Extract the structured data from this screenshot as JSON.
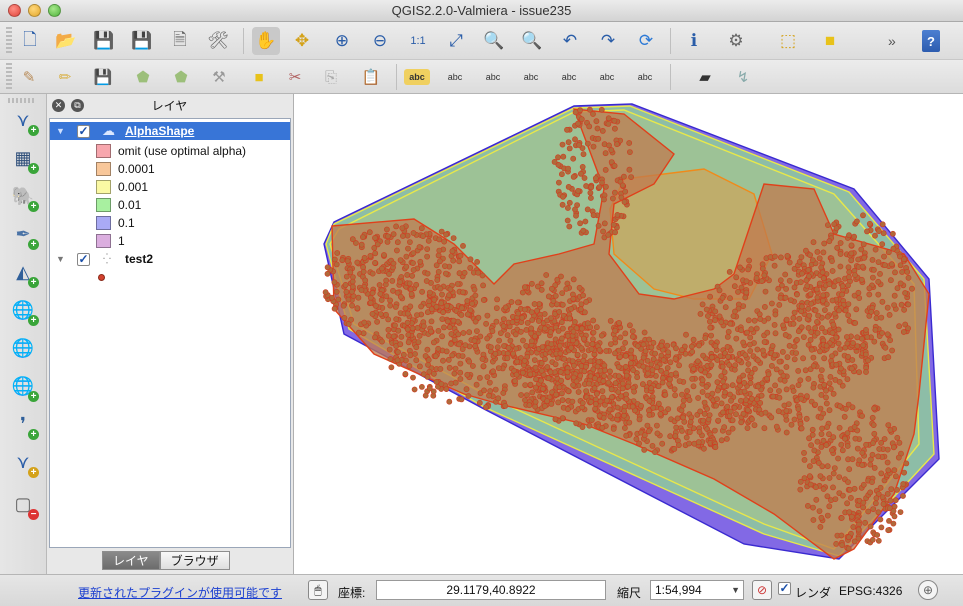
{
  "window": {
    "title": "QGIS2.2.0-Valmiera - issue235"
  },
  "toolbar_top": {
    "buttons": [
      "new-project",
      "open-project",
      "save-project",
      "save-as",
      "new-print-composer",
      "composer-manager",
      "pan",
      "pan-to-selection",
      "zoom-in",
      "zoom-out",
      "zoom-actual",
      "zoom-full",
      "zoom-layer",
      "zoom-selection",
      "zoom-last",
      "zoom-next",
      "refresh",
      "identify",
      "actions",
      "select",
      "deselect"
    ],
    "overflow": "»",
    "help": "?"
  },
  "toolbar_second": {
    "buttons": [
      "current-edits",
      "toggle-editing",
      "save-edits",
      "add-feature",
      "move-feature",
      "node-tool",
      "delete-selected",
      "cut-features",
      "copy-features",
      "paste-features",
      "label-abc",
      "label-pin",
      "label-show-hide",
      "label-move",
      "label-rotate",
      "label-change",
      "label-settings",
      "oracle-spatial",
      "add-wfs"
    ],
    "label_text": "abc"
  },
  "left_toolbar": {
    "buttons": [
      "add-vector-layer",
      "add-raster-layer",
      "add-postgis-layer",
      "add-spatialite-layer",
      "add-mssql-layer",
      "add-wms-layer",
      "add-wcs-layer",
      "add-wfs-layer",
      "add-delimited-text-layer",
      "new-shapefile-layer",
      "remove-layer"
    ]
  },
  "layers_panel": {
    "title": "レイヤ",
    "layers": [
      {
        "name": "AlphaShape",
        "checked": true,
        "selected": true,
        "legend": [
          {
            "label": "omit (use optimal alpha)",
            "color": "#f7a6ad"
          },
          {
            "label": "0.0001",
            "color": "#f8c79a"
          },
          {
            "label": "0.001",
            "color": "#fbf9a4"
          },
          {
            "label": "0.01",
            "color": "#a8f0a0"
          },
          {
            "label": "0.1",
            "color": "#a9aaf5"
          },
          {
            "label": "1",
            "color": "#dbaedf"
          }
        ]
      },
      {
        "name": "test2",
        "checked": true,
        "selected": false,
        "point_color": "#d2412e"
      }
    ],
    "tabs": [
      {
        "label": "レイヤ",
        "active": true
      },
      {
        "label": "ブラウザ",
        "active": false
      }
    ]
  },
  "map": {
    "colors": {
      "alpha_1": "#6c4fe0",
      "alpha_0_1": "#8f7fd8",
      "alpha_0_01": "#8ec7a0",
      "alpha_0_001": "#a9c48a",
      "alpha_0_0001": "#c8a860",
      "omit": "#c07a4e",
      "points_fill": "#b06a3a",
      "points_stroke": "#d03a22"
    }
  },
  "status_bar": {
    "plugin_notice": "更新されたプラグインが使用可能です",
    "coord_label": "座標:",
    "coord_value": "29.1179,40.8922",
    "scale_label": "縮尺",
    "scale_value": "1:54,994",
    "render_label": "レンダ",
    "render_checked": true,
    "crs": "EPSG:4326"
  }
}
